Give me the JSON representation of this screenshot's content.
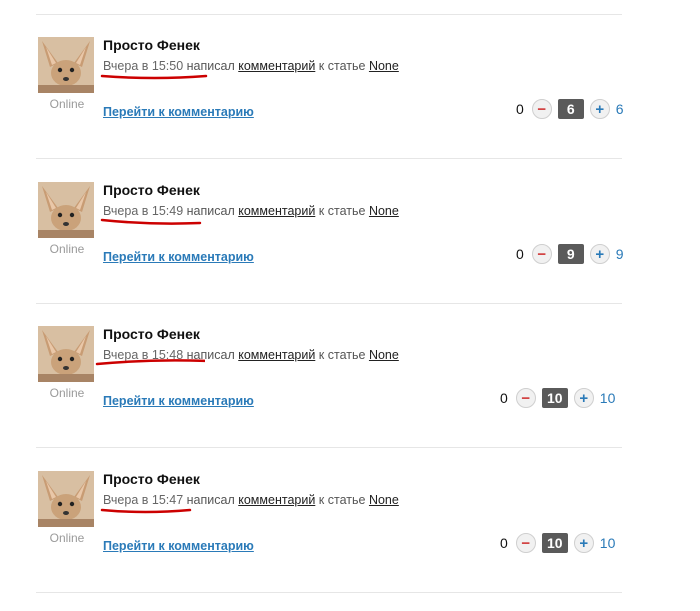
{
  "feed": {
    "items": [
      {
        "author": "Просто Фенек",
        "status": "Online",
        "time": "Вчера в 15:50",
        "action": "написал",
        "target_link": "комментарий",
        "target_prefix": "к статье",
        "article_link": "None",
        "goto_link": "Перейти к комментарию",
        "minus_count": "0",
        "score": "6",
        "plus_count": "6"
      },
      {
        "author": "Просто Фенек",
        "status": "Online",
        "time": "Вчера в 15:49",
        "action": "написал",
        "target_link": "комментарий",
        "target_prefix": "к статье",
        "article_link": "None",
        "goto_link": "Перейти к комментарию",
        "minus_count": "0",
        "score": "9",
        "plus_count": "9"
      },
      {
        "author": "Просто Фенек",
        "status": "Online",
        "time": "Вчера в 15:48",
        "action": "написал",
        "target_link": "комментарий",
        "target_prefix": "к статье",
        "article_link": "None",
        "goto_link": "Перейти к комментарию",
        "minus_count": "0",
        "score": "10",
        "plus_count": "10"
      },
      {
        "author": "Просто Фенек",
        "status": "Online",
        "time": "Вчера в 15:47",
        "action": "написал",
        "target_link": "комментарий",
        "target_prefix": "к статье",
        "article_link": "None",
        "goto_link": "Перейти к комментарию",
        "minus_count": "0",
        "score": "10",
        "plus_count": "10"
      }
    ]
  },
  "icons": {
    "minus": "minus-icon",
    "plus": "plus-icon",
    "avatar": "fennec-fox-avatar"
  },
  "colors": {
    "link": "#2a7ab8",
    "minus": "#d03a3a",
    "annotation": "#cc0000",
    "score_bg": "#5a5a5a"
  }
}
